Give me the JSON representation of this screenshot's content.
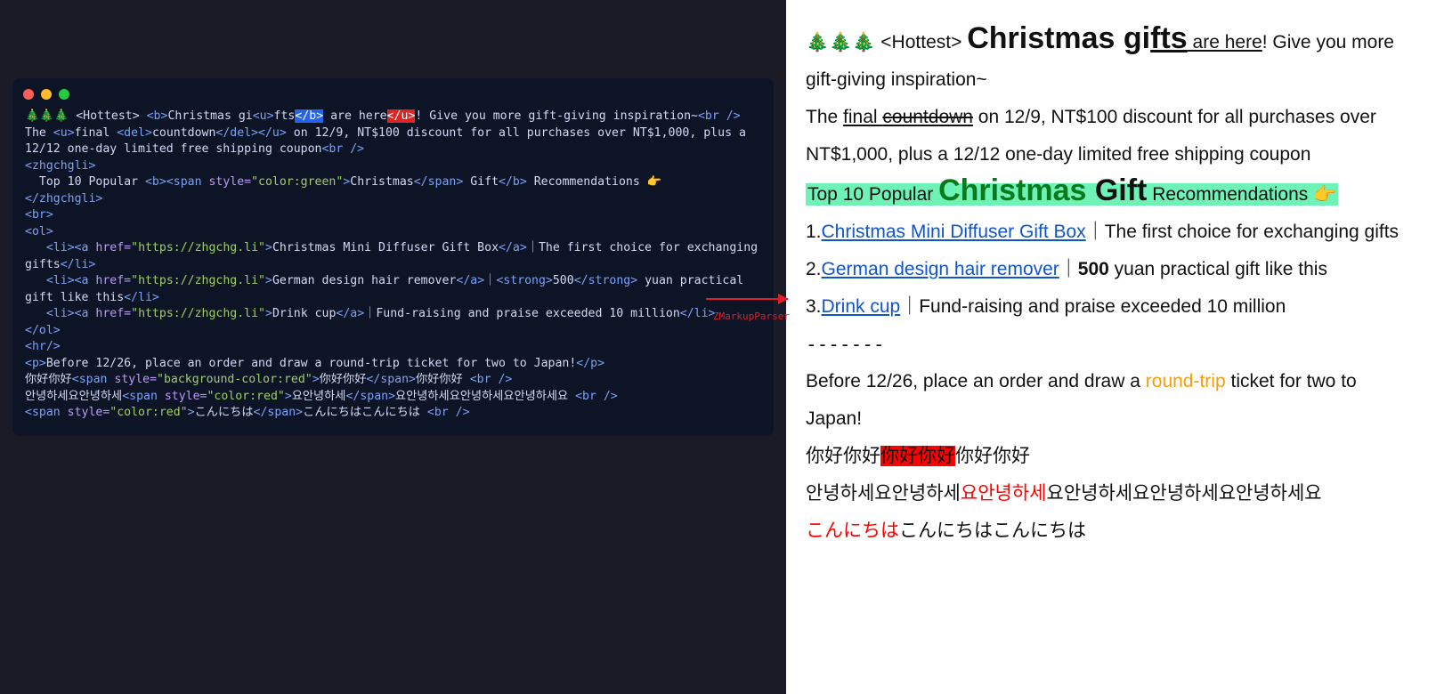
{
  "arrow_label": "ZMarkupParser",
  "source_html": {
    "line1_emoji": "🎄🎄🎄",
    "line1_a": " <Hottest> ",
    "line1_b_open": "<b>",
    "line1_text1": "Christmas gi",
    "line1_u_open": "<u>",
    "line1_text2": "fts",
    "line1_b_close_hl": "</b>",
    "line1_text3": " are here",
    "line1_u_close_hl": "</u>",
    "line1_text4": "! Give you more gift-giving inspiration~",
    "line1_br": "<br />",
    "line2_a": "The ",
    "line2_u_open": "<u>",
    "line2_b": "final ",
    "line2_del_open": "<del>",
    "line2_c": "countdown",
    "line2_del_close": "</del>",
    "line2_u_close": "</u>",
    "line2_d": " on 12/9, NT$100 discount for all purchases over NT$1,000, plus a 12/12 one-day limited free shipping coupon",
    "line2_br": "<br />",
    "line3_open": "<zhgchgli>",
    "line4_a": "  Top 10 Popular ",
    "line4_b_open": "<b>",
    "line4_span_open": "<span ",
    "line4_attr": "style=",
    "line4_style": "\"color:green\"",
    "line4_span_open_end": ">",
    "line4_b": "Christmas",
    "line4_span_close": "</span>",
    "line4_c": " Gift",
    "line4_b_close": "</b>",
    "line4_d": " Recommendations 👉",
    "line5_close": "</zhgchgli>",
    "line6_br": "<br>",
    "line7_ol": "<ol>",
    "line8_a": "   ",
    "line8_li": "<li>",
    "line8_a_open": "<a ",
    "line8_href": "href=",
    "line8_url": "\"https://zhgchg.li\"",
    "line8_a_open_end": ">",
    "line8_text": "Christmas Mini Diffuser Gift Box",
    "line8_a_close": "</a>",
    "line8_rest": "｜The first choice for exchanging gifts",
    "line8_li_close": "</li>",
    "line9_a": "   ",
    "line9_text": "German design hair remover",
    "line9_rest_a": "｜",
    "line9_strong_open": "<strong>",
    "line9_num": "500",
    "line9_strong_close": "</strong>",
    "line9_rest_b": " yuan practical gift like this",
    "line10_a": "   ",
    "line10_text": "Drink cup",
    "line10_rest": "｜Fund-raising and praise exceeded 10 million",
    "line11_ol_close": "</ol>",
    "line12_hr": "<hr/>",
    "line13_p_open": "<p>",
    "line13_text": "Before 12/26, place an order and draw a round-trip ticket for two to Japan!",
    "line13_p_close": "</p>",
    "line14_a": "你好你好",
    "line14_span_open": "<span ",
    "line14_attr": "style=",
    "line14_style": "\"background-color:red\"",
    "line14_span_open_end": ">",
    "line14_b": "你好你好",
    "line14_span_close": "</span>",
    "line14_c": "你好你好 ",
    "line14_br": "<br />",
    "line15_a": "안녕하세요안녕하세",
    "line15_style": "\"color:red\"",
    "line15_b": "요안녕하세",
    "line15_c": "요안녕하세요안녕하세요안녕하세요 ",
    "line16_style": "\"color:red\"",
    "line16_a": "こんにちは",
    "line16_b": "こんにちはこんにちは "
  },
  "rendered": {
    "r1_emoji": "🎄🎄🎄",
    "r1_hottest": " <Hottest> ",
    "r1_big1": "Christmas gi",
    "r1_big2": "fts",
    "r1_under": " are here",
    "r1_rest": "! Give you more gift-giving inspiration~",
    "r2_a": "The ",
    "r2_b": "final ",
    "r2_c": "countdown",
    "r2_d": " on 12/9, NT$100 discount for all purchases over NT$1,000, plus a 12/12 one-day limited free shipping coupon",
    "r3_a": "Top 10 Popular ",
    "r3_b": "Christmas",
    "r3_c": " Gift",
    "r3_d": " Recommendations 👉",
    "r4_num": "1.",
    "r4_link": "Christmas Mini Diffuser Gift Box",
    "r4_rest": "｜The first choice for exchanging gifts",
    "r5_num": "2.",
    "r5_link": "German design hair remover",
    "r5_rest_a": "｜",
    "r5_num_b": "500",
    "r5_rest_b": " yuan practical gift like this",
    "r6_num": "3.",
    "r6_link": "Drink cup",
    "r6_rest": "｜Fund-raising and praise exceeded 10 million",
    "r7_hr": "-------",
    "r8_a": "Before 12/26, place an order and draw a ",
    "r8_b": "round-trip",
    "r8_c": " ticket for two to Japan!",
    "r9_a": "你好你好",
    "r9_b": "你好你好",
    "r9_c": "你好你好",
    "r10_a": "안녕하세요안녕하세",
    "r10_b": "요안녕하세",
    "r10_c": "요안녕하세요안녕하세요안녕하세요",
    "r11_a": "こんにちは",
    "r11_b": "こんにちはこんにちは"
  }
}
